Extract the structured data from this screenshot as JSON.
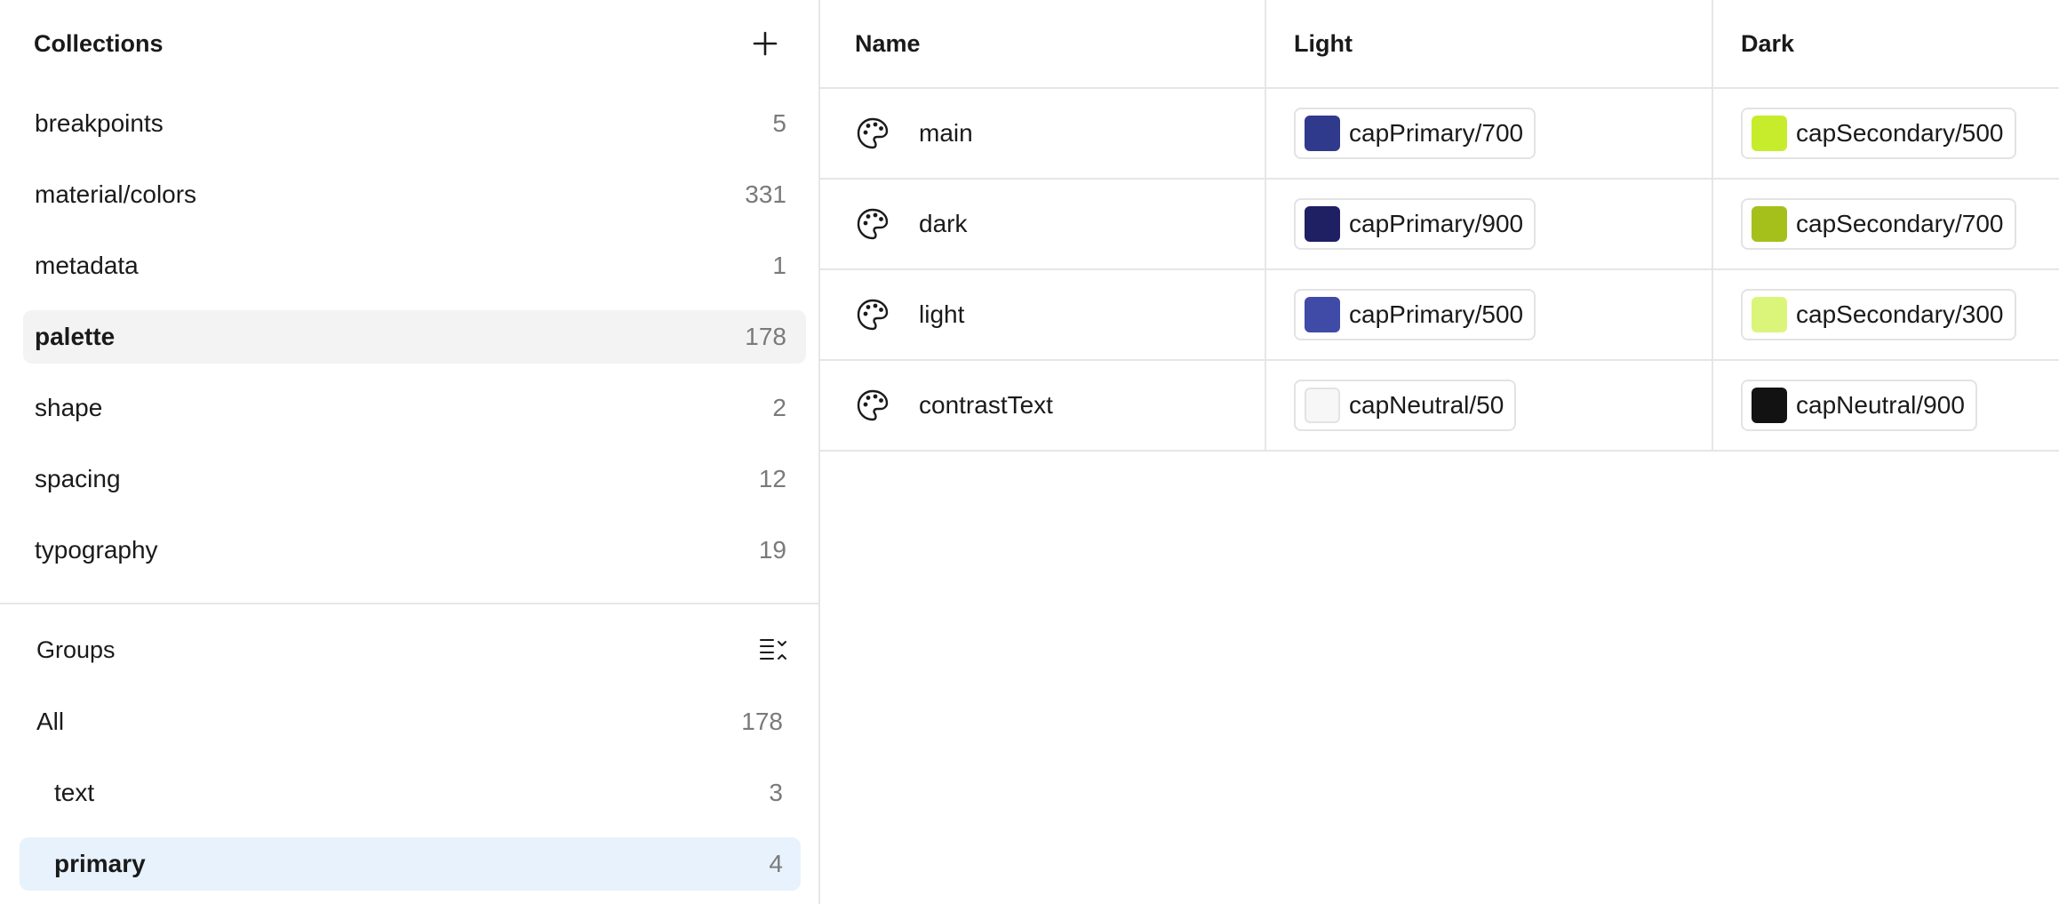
{
  "collections": {
    "title": "Collections",
    "add_icon": "plus-icon",
    "items": [
      {
        "label": "breakpoints",
        "count": "5"
      },
      {
        "label": "material/colors",
        "count": "331"
      },
      {
        "label": "metadata",
        "count": "1"
      },
      {
        "label": "palette",
        "count": "178"
      },
      {
        "label": "shape",
        "count": "2"
      },
      {
        "label": "spacing",
        "count": "12"
      },
      {
        "label": "typography",
        "count": "19"
      }
    ],
    "selected": "palette"
  },
  "groups": {
    "title": "Groups",
    "sort_icon": "collapse-expand-list-icon",
    "items": [
      {
        "label": "All",
        "count": "178"
      },
      {
        "label": "text",
        "count": "3"
      },
      {
        "label": "primary",
        "count": "4"
      }
    ],
    "selected": "primary"
  },
  "table": {
    "headers": {
      "name": "Name",
      "light": "Light",
      "dark": "Dark"
    },
    "row_icon": "palette-icon",
    "rows": [
      {
        "name": "main",
        "light": {
          "label": "capPrimary/700",
          "color": "#303a8c"
        },
        "dark": {
          "label": "capSecondary/500",
          "color": "#c6ec2c"
        }
      },
      {
        "name": "dark",
        "light": {
          "label": "capPrimary/900",
          "color": "#1f1f63"
        },
        "dark": {
          "label": "capSecondary/700",
          "color": "#a5c01b"
        }
      },
      {
        "name": "light",
        "light": {
          "label": "capPrimary/500",
          "color": "#3f4ba6"
        },
        "dark": {
          "label": "capSecondary/300",
          "color": "#dbf57a"
        }
      },
      {
        "name": "contrastText",
        "light": {
          "label": "capNeutral/50",
          "color": "#f7f7f7"
        },
        "dark": {
          "label": "capNeutral/900",
          "color": "#121212"
        }
      }
    ]
  }
}
